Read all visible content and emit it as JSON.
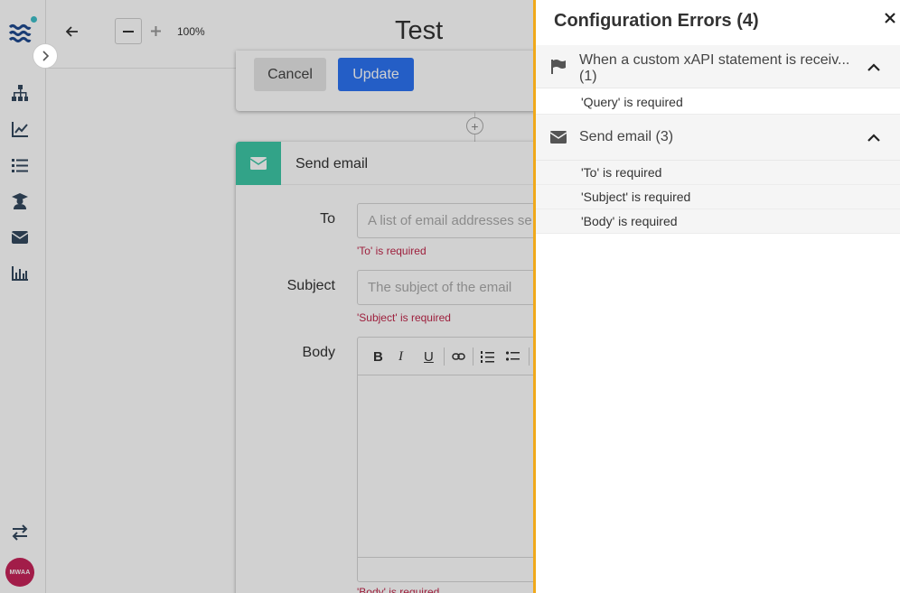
{
  "sidebar": {
    "nav": [
      {
        "icon": "org-chart-icon"
      },
      {
        "icon": "trend-chart-icon"
      },
      {
        "icon": "list-icon"
      },
      {
        "icon": "graduate-icon"
      },
      {
        "icon": "envelope-icon"
      },
      {
        "icon": "bar-chart-icon"
      }
    ],
    "bottom_icon": "swap-arrows-icon",
    "avatar_text": "MWAA",
    "accent": "#3fbfc9",
    "avatar_color": "#c6245a"
  },
  "toolbar": {
    "zoom_level": "100%",
    "title": "Test"
  },
  "update_card": {
    "cancel_label": "Cancel",
    "update_label": "Update"
  },
  "email_card": {
    "title": "Send email",
    "to_label": "To",
    "to_placeholder": "A list of email addresses se",
    "to_error": "'To' is required",
    "subject_label": "Subject",
    "subject_placeholder": "The subject of the email",
    "subject_error": "'Subject' is required",
    "body_label": "Body",
    "body_error": "'Body' is required",
    "toolbar_buttons": [
      "B",
      "I",
      "U"
    ],
    "accent": "#3ec7a7"
  },
  "error_panel": {
    "title": "Configuration Errors (4)",
    "accent": "#f0a91b",
    "groups": [
      {
        "icon": "flag-icon",
        "label": "When a custom xAPI statement is receiv...",
        "count": "(1)",
        "errors": [
          "'Query' is required"
        ]
      },
      {
        "icon": "envelope-icon",
        "label": "Send email (3)",
        "errors": [
          "'To' is required",
          "'Subject' is required",
          "'Body' is required"
        ]
      }
    ]
  }
}
